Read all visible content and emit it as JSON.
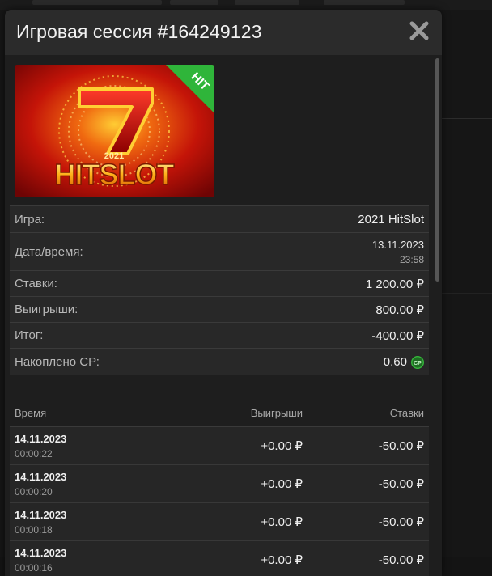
{
  "modal": {
    "title": "Игровая сессия #164249123",
    "close_icon": "close-icon"
  },
  "game": {
    "hit_badge": "HIT",
    "year": "2021",
    "logo_text": "HITSLOT"
  },
  "info": {
    "game_label": "Игра:",
    "game_value": "2021 HitSlot",
    "datetime_label": "Дата/время:",
    "date_value": "13.11.2023",
    "time_value": "23:58",
    "bets_label": "Ставки:",
    "bets_value": "1 200.00 ₽",
    "wins_label": "Выигрыши:",
    "wins_value": "800.00 ₽",
    "total_label": "Итог:",
    "total_value": "-400.00 ₽",
    "cp_label": "Накоплено СР:",
    "cp_value": "0.60",
    "cp_badge": "CP"
  },
  "table": {
    "headers": {
      "time": "Время",
      "wins": "Выигрыши",
      "bets": "Ставки"
    },
    "rows": [
      {
        "date": "14.11.2023",
        "time": "00:00:22",
        "win": "+0.00 ₽",
        "bet": "-50.00 ₽"
      },
      {
        "date": "14.11.2023",
        "time": "00:00:20",
        "win": "+0.00 ₽",
        "bet": "-50.00 ₽"
      },
      {
        "date": "14.11.2023",
        "time": "00:00:18",
        "win": "+0.00 ₽",
        "bet": "-50.00 ₽"
      },
      {
        "date": "14.11.2023",
        "time": "00:00:16",
        "win": "+0.00 ₽",
        "bet": "-50.00 ₽"
      }
    ]
  },
  "colors": {
    "accent_green": "#35b93b",
    "modal_bg": "#2b2b2b",
    "body_bg": "#1e1e1e"
  }
}
